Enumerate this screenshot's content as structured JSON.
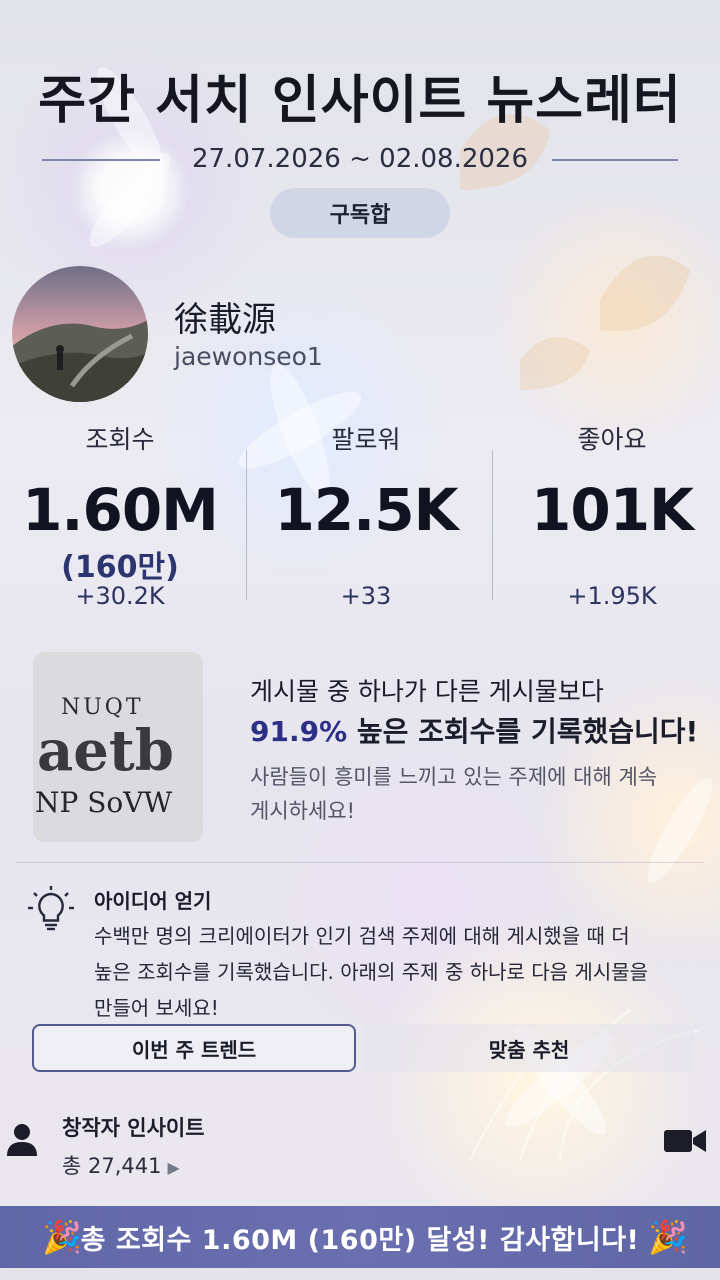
{
  "header": {
    "title": "주간 서치 인사이트 뉴스레터",
    "date_range": "27.07.2026 ~ 02.08.2026",
    "subscribe_label": "구독합"
  },
  "profile": {
    "name": "徐載源",
    "handle": "jaewonseo1"
  },
  "stats": [
    {
      "label": "조회수",
      "value": "1.60M",
      "sub": "(160만)",
      "delta": "+30.2K"
    },
    {
      "label": "팔로워",
      "value": "12.5K",
      "sub": "",
      "delta": "+33"
    },
    {
      "label": "좋아요",
      "value": "101K",
      "sub": "",
      "delta": "+1.95K"
    }
  ],
  "post_insight": {
    "line1": "게시물 중 하나가 다른 게시물보다",
    "percent": "91.9%",
    "line2_rest": " 높은 조회수를 기록했습니다!",
    "line3": "사람들이 흥미를 느끼고 있는 주제에 대해 계속 게시하세요!",
    "thumb_text": [
      "NUQT",
      "aetb",
      "NP SoVW"
    ]
  },
  "ideas": {
    "title": "아이디어 얻기",
    "body": "수백만 명의 크리에이터가 인기 검색 주제에 대해 게시했을 때 더 높은 조회수를 기록했습니다. 아래의 주제 중 하나로 다음 게시물을 만들어 보세요!",
    "buttons": {
      "trend": "이번 주 트렌드",
      "recommend": "맞춤 추천"
    }
  },
  "creator": {
    "title": "창작자 인사이트",
    "count": "총 27,441",
    "play_glyph": "▶"
  },
  "banner": {
    "text": "총 조회수 1.60M (160만) 달성! 감사합니다!",
    "left_icon": "🎉",
    "right_icon": "🎉"
  },
  "colors": {
    "accent": "#2d2f86",
    "banner": "#6067a6",
    "delta": "#2e3460"
  }
}
